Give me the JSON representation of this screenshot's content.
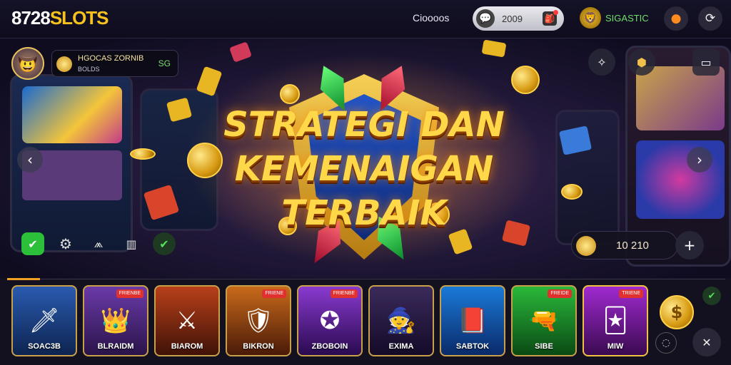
{
  "header": {
    "logo_num": "8728",
    "logo_text": "SLOTS",
    "label": "Cioooos",
    "search_value": "2009",
    "user_name": "SIGASTIC"
  },
  "hero": {
    "headline_line1": "STRATEGI DAN",
    "headline_line2": "KEMENAIGAN TERBAIK",
    "balance_line1": "HGOCAS ZORNIB",
    "balance_line2": "BOLDS",
    "balance_right": "SG",
    "score_value": "10 210"
  },
  "games": [
    {
      "label": "SOAC3B",
      "badge": ""
    },
    {
      "label": "BLRAIDM",
      "badge": "FRIENBE"
    },
    {
      "label": "BIAROM",
      "badge": ""
    },
    {
      "label": "BIKRON",
      "badge": "FRIENE"
    },
    {
      "label": "ZBOBOIN",
      "badge": "FRIENBE"
    },
    {
      "label": "EXIMA",
      "badge": ""
    },
    {
      "label": "SABTOK",
      "badge": ""
    },
    {
      "label": "SIBE",
      "badge": "FREIDE"
    },
    {
      "label": "MIW",
      "badge": "TRIENE"
    }
  ],
  "icons": {
    "logo": "logo",
    "chat": "chat-icon",
    "bag": "bag-icon",
    "settings": "settings-icon",
    "orange_button": "fire-icon",
    "gray_button": "refresh-icon",
    "compass": "compass-icon",
    "chest": "chest-icon",
    "fullscreen": "fullscreen-icon"
  },
  "colors": {
    "accent": "#f7c21e",
    "green": "#2bbf3a",
    "background": "#0d0a1a"
  }
}
